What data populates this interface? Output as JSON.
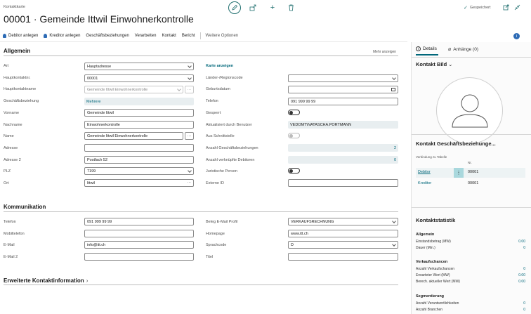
{
  "header": {
    "page_type": "Kontaktkarte",
    "title": "00001 · Gemeinde Ittwil Einwohnerkontrolle",
    "saved_label": "Gespeichert"
  },
  "actions": {
    "debitor": "Debitor anlegen",
    "kreditor": "Kreditor anlegen",
    "beziehungen": "Geschäftsbeziehungen",
    "verarbeiten": "Verarbeiten",
    "kontakt": "Kontakt",
    "bericht": "Bericht",
    "weitere": "Weitere Optionen"
  },
  "allgemein": {
    "title": "Allgemein",
    "mehr": "Mehr anzeigen",
    "art": {
      "label": "Art",
      "value": "Hauptadresse"
    },
    "hauptkontaktnr": {
      "label": "Hauptkontaktnr.",
      "value": "00001"
    },
    "hauptkontaktname": {
      "label": "Hauptkontaktname",
      "value": "Gemeinde Ittwil Einwohnerkontrolle"
    },
    "geschaeftsbeziehung": {
      "label": "Geschäftsbeziehung",
      "value": "Mehrere"
    },
    "vorname": {
      "label": "Vorname",
      "value": "Gemeinde Ittwil"
    },
    "nachname": {
      "label": "Nachname",
      "value": "Einwohnerkontrolle"
    },
    "name": {
      "label": "Name",
      "value": "Gemeinde Ittwil Einwohnerkontrolle"
    },
    "adresse": {
      "label": "Adresse",
      "value": ""
    },
    "adresse2": {
      "label": "Adresse 2",
      "value": "Postfach 52"
    },
    "plz": {
      "label": "PLZ",
      "value": "7199"
    },
    "ort": {
      "label": "Ort",
      "value": "Ittwil"
    },
    "karte": "Karte anzeigen",
    "laender": {
      "label": "Länder-/Regionscode",
      "value": ""
    },
    "geburtsdatum": {
      "label": "Geburtsdatum",
      "value": ""
    },
    "telefon": {
      "label": "Telefon",
      "value": "091 999 99 99"
    },
    "gesperrt": {
      "label": "Gesperrt"
    },
    "aktualisiert": {
      "label": "Aktualisiert durch Benutzer",
      "value": "VEDOMT\\NATASCHA.PORTMANN"
    },
    "schnittstelle": {
      "label": "Aus Schnittstelle"
    },
    "anzahl_gb": {
      "label": "Anzahl Geschäftsbeziehungen",
      "value": "2"
    },
    "anzahl_deb": {
      "label": "Anzahl verknüpfte Debitoren",
      "value": "0"
    },
    "juristisch": {
      "label": "Juristische Person"
    },
    "externe_id": {
      "label": "Externe ID",
      "value": ""
    }
  },
  "kommunikation": {
    "title": "Kommunikation",
    "telefon": {
      "label": "Telefon",
      "value": "091 999 99 99"
    },
    "mobil": {
      "label": "Mobiltelefon",
      "value": ""
    },
    "email": {
      "label": "E-Mail",
      "value": "info@itt.ch"
    },
    "email2": {
      "label": "E-Mail 2",
      "value": ""
    },
    "beleg": {
      "label": "Beleg E-Mail Profil",
      "value": "VERKAUFSRECHNUNG"
    },
    "homepage": {
      "label": "Homepage",
      "value": "www.itt.ch"
    },
    "sprachcode": {
      "label": "Sprachcode",
      "value": "D"
    },
    "titel": {
      "label": "Titel",
      "value": ""
    }
  },
  "erweitert": {
    "title": "Erweiterte Kontaktinformation"
  },
  "factbox": {
    "tab_details": "Details",
    "tab_anhaenge": "Anhänge (0)",
    "bild_title": "Kontakt Bild",
    "gb_title": "Kontakt Geschäftsbeziehunge...",
    "gb_col1": "Verbindung zu Tabelle",
    "gb_col2": "Nr.",
    "gb_rows": [
      {
        "table": "Debitor",
        "nr": "00001"
      },
      {
        "table": "Kreditor",
        "nr": "00001"
      }
    ],
    "stat_title": "Kontaktstatistik",
    "allgemein": "Allgemein",
    "einstand": {
      "label": "Einstandsbetrag (MW)",
      "value": "0.00"
    },
    "dauer": {
      "label": "Dauer (Min.)",
      "value": "0"
    },
    "verkaufschancen": "Verkaufschancen",
    "anzahl_vk": {
      "label": "Anzahl Verkaufschancen",
      "value": "0"
    },
    "erwartet": {
      "label": "Erwarteter Wert (MW)",
      "value": "0.00"
    },
    "berech": {
      "label": "Berech. aktueller Wert (MW)",
      "value": "0.00"
    },
    "segmentierung": "Segmentierung",
    "anzahl_verant": {
      "label": "Anzahl Verantwortlichkeiten",
      "value": "0"
    },
    "anzahl_branchen": {
      "label": "Anzahl Branchen",
      "value": "0"
    }
  },
  "colors": {
    "accent": "#00677a",
    "icon": "#1f6f6f",
    "gray_field": "#e8eef0"
  }
}
